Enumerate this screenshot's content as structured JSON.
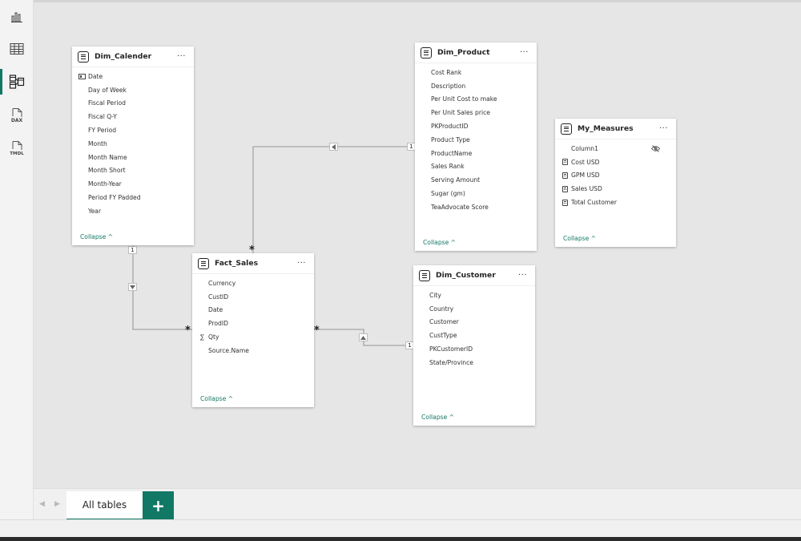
{
  "rail": {
    "items": [
      {
        "name": "report-view-icon",
        "label": "",
        "active": false
      },
      {
        "name": "table-view-icon",
        "label": "",
        "active": false
      },
      {
        "name": "model-view-icon",
        "label": "",
        "active": true
      },
      {
        "name": "dax-query-view-icon",
        "label": "DAX",
        "active": false
      },
      {
        "name": "tmdl-view-icon",
        "label": "TMDL",
        "active": false
      }
    ]
  },
  "tables": {
    "dim_calender": {
      "title": "Dim_Calender",
      "fields": [
        "Date",
        "Day of Week",
        "Fiscal Period",
        "Fiscal Q-Y",
        "FY Period",
        "Month",
        "Month Name",
        "Month Short",
        "Month-Year",
        "Period FY Padded",
        "Year"
      ],
      "collapse": "Collapse ^"
    },
    "dim_product": {
      "title": "Dim_Product",
      "fields": [
        "Cost Rank",
        "Description",
        "Per Unit Cost to make",
        "Per Unit Sales price",
        "PKProductID",
        "Product Type",
        "ProductName",
        "Sales Rank",
        "Serving Amount",
        "Sugar (gm)",
        "TeaAdvocate Score"
      ],
      "collapse": "Collapse ^"
    },
    "my_measures": {
      "title": "My_Measures",
      "fields": [
        "Column1",
        "Cost USD",
        "GPM USD",
        "Sales USD",
        "Total Customer"
      ],
      "collapse": "Collapse ^"
    },
    "fact_sales": {
      "title": "Fact_Sales",
      "fields": [
        "Currency",
        "CustID",
        "Date",
        "ProdID",
        "Qty",
        "Source.Name"
      ],
      "collapse": "Collapse ^"
    },
    "dim_customer": {
      "title": "Dim_Customer",
      "fields": [
        "City",
        "Country",
        "Customer",
        "CustType",
        "PKCustomerID",
        "State/Province"
      ],
      "collapse": "Collapse ^"
    }
  },
  "relationships": {
    "one": "1",
    "many": "*"
  },
  "more_menu": "···",
  "tabs": {
    "active_label": "All tables",
    "add_label": "+"
  },
  "colors": {
    "accent": "#117865",
    "canvas": "#e6e6e6",
    "line": "#a6a6a6"
  }
}
